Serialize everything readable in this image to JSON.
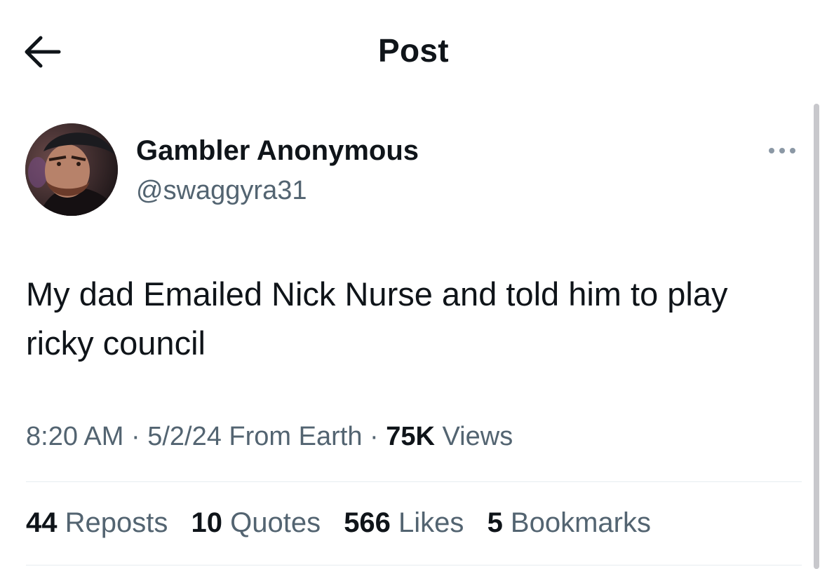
{
  "header": {
    "title": "Post",
    "back_icon": "arrow-left-icon"
  },
  "post": {
    "author": {
      "display_name": "Gambler Anonymous",
      "handle": "@swaggyra31",
      "avatar": "avatar-photo"
    },
    "more_icon": "more-dots-icon",
    "text": "My dad Emailed Nick Nurse and told him to play ricky council",
    "meta": {
      "time": "8:20 AM",
      "sep1": " · ",
      "date": "5/2/24",
      "location": " From Earth",
      "sep2": " · ",
      "views_count": "75K",
      "views_label": " Views"
    },
    "stats": {
      "reposts_count": "44",
      "reposts_label": " Reposts",
      "quotes_count": "10",
      "quotes_label": " Quotes",
      "likes_count": "566",
      "likes_label": " Likes",
      "bookmarks_count": "5",
      "bookmarks_label": " Bookmarks"
    }
  },
  "colors": {
    "text": "#0f1419",
    "secondary": "#536471",
    "divider": "#e6ecf0"
  }
}
